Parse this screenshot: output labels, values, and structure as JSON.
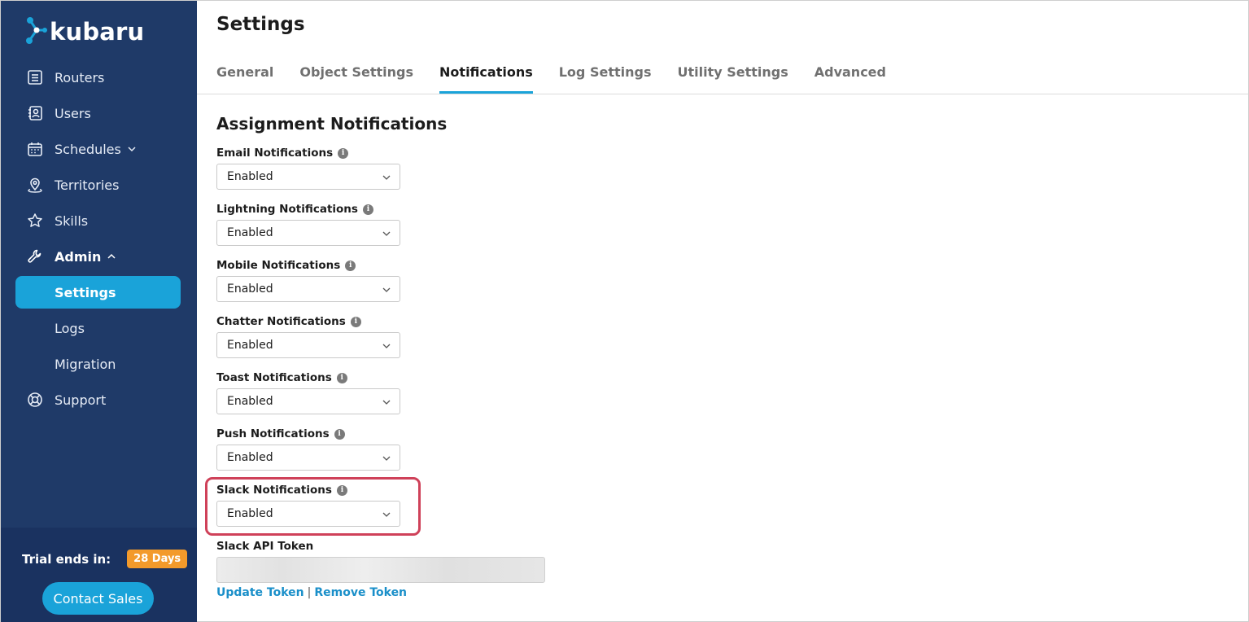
{
  "brand": {
    "name": "kubaru"
  },
  "sidebar": {
    "items": [
      {
        "label": "Routers",
        "icon": "routers-icon"
      },
      {
        "label": "Users",
        "icon": "users-icon"
      },
      {
        "label": "Schedules",
        "icon": "calendar-icon"
      },
      {
        "label": "Territories",
        "icon": "map-pin-icon"
      },
      {
        "label": "Skills",
        "icon": "star-icon"
      },
      {
        "label": "Admin",
        "icon": "wrench-icon"
      },
      {
        "label": "Support",
        "icon": "lifebuoy-icon"
      }
    ],
    "admin_sub": [
      {
        "label": "Settings",
        "active": true
      },
      {
        "label": "Logs"
      },
      {
        "label": "Migration"
      }
    ],
    "trial_label": "Trial ends in:",
    "trial_badge": "28 Days",
    "contact_button": "Contact Sales"
  },
  "page": {
    "title": "Settings"
  },
  "tabs": [
    {
      "label": "General"
    },
    {
      "label": "Object Settings"
    },
    {
      "label": "Notifications",
      "active": true
    },
    {
      "label": "Log Settings"
    },
    {
      "label": "Utility Settings"
    },
    {
      "label": "Advanced"
    }
  ],
  "section": {
    "title": "Assignment Notifications"
  },
  "fields": [
    {
      "label": "Email Notifications",
      "value": "Enabled"
    },
    {
      "label": "Lightning Notifications",
      "value": "Enabled"
    },
    {
      "label": "Mobile Notifications",
      "value": "Enabled"
    },
    {
      "label": "Chatter Notifications",
      "value": "Enabled"
    },
    {
      "label": "Toast Notifications",
      "value": "Enabled"
    },
    {
      "label": "Push Notifications",
      "value": "Enabled"
    },
    {
      "label": "Slack Notifications",
      "value": "Enabled"
    }
  ],
  "token": {
    "label": "Slack API Token",
    "update_link": "Update Token",
    "separator": "|",
    "remove_link": "Remove Token"
  },
  "colors": {
    "sidebar_bg": "#1f3a68",
    "accent": "#1aa3d9",
    "badge": "#f39a2b",
    "highlight": "#cf4159"
  }
}
